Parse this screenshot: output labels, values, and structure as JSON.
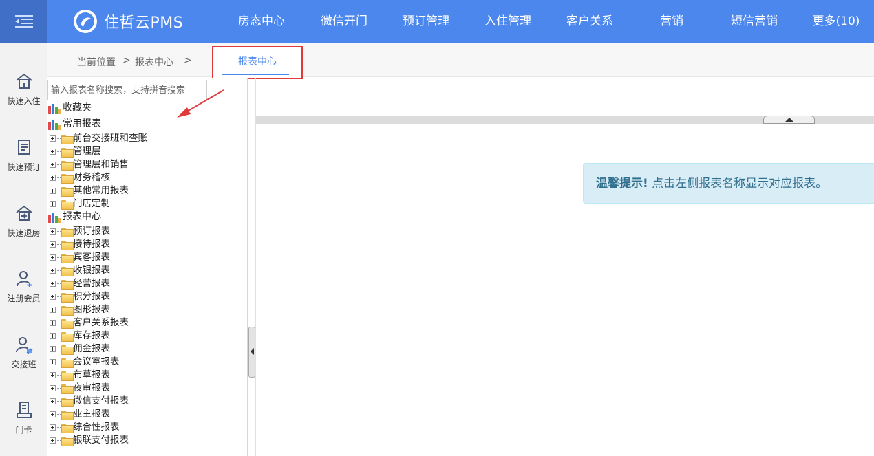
{
  "header": {
    "brand": "住哲云PMS",
    "nav": [
      "房态中心",
      "微信开门",
      "预订管理",
      "入住管理",
      "客户关系",
      "营销",
      "短信营销",
      "更多(10)"
    ]
  },
  "rail": [
    {
      "label": "快速入住",
      "icon": "home-icon"
    },
    {
      "label": "快速预订",
      "icon": "booking-icon"
    },
    {
      "label": "快速退房",
      "icon": "checkout-icon"
    },
    {
      "label": "注册会员",
      "icon": "add-user-icon"
    },
    {
      "label": "交接班",
      "icon": "handover-icon"
    },
    {
      "label": "门卡",
      "icon": "card-icon"
    }
  ],
  "breadcrumb": {
    "prefix": "当前位置",
    "sep1": ">",
    "item": "报表中心",
    "sep2": ">"
  },
  "active_tab": "报表中心",
  "search": {
    "placeholder": "输入报表名称搜索，支持拼音搜索"
  },
  "tree": {
    "favorites": "收藏夹",
    "common": "常用报表",
    "common_children": [
      "前台交接班和查账",
      "管理层",
      "管理层和销售",
      "财务稽核",
      "其他常用报表",
      "门店定制"
    ],
    "center": "报表中心",
    "center_children": [
      "预订报表",
      "接待报表",
      "宾客报表",
      "收银报表",
      "经营报表",
      "积分报表",
      "图形报表",
      "客户关系报表",
      "库存报表",
      "佣金报表",
      "会议室报表",
      "布草报表",
      "夜审报表",
      "微信支付报表",
      "业主报表",
      "综合性报表",
      "银联支付报表"
    ]
  },
  "tip": {
    "strong": "温馨提示!",
    "text": " 点击左侧报表名称显示对应报表。"
  },
  "colors": {
    "primary": "#4b87ec",
    "annotation": "#e03b3b",
    "tip_bg": "#d9edf7"
  }
}
